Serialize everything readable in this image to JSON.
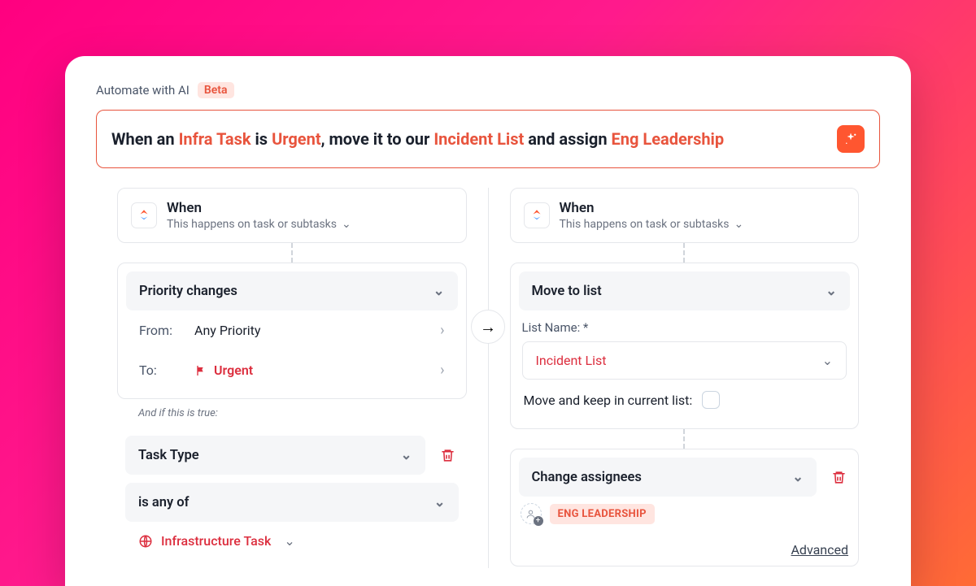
{
  "header": {
    "title": "Automate with AI",
    "badge": "Beta"
  },
  "prompt": {
    "prefix": "When an ",
    "h1": "Infra Task",
    "mid1": " is ",
    "h2": "Urgent",
    "mid2": ", move it to our ",
    "h3": "Incident List",
    "mid3": " and assign ",
    "h4": "Eng Leadership"
  },
  "left": {
    "when": {
      "title": "When",
      "sub": "This happens on task or subtasks"
    },
    "trigger": {
      "label": "Priority changes",
      "from_lbl": "From:",
      "from_val": "Any Priority",
      "to_lbl": "To:",
      "to_val": "Urgent"
    },
    "cond_hdr": "And if this is true:",
    "cond": {
      "field": "Task Type",
      "op": "is any of",
      "value": "Infrastructure Task"
    }
  },
  "right": {
    "when": {
      "title": "When",
      "sub": "This happens on task or subtasks"
    },
    "action1": {
      "label": "Move to list",
      "field_lbl": "List Name: *",
      "value": "Incident List",
      "keep_lbl": "Move and keep in current list:"
    },
    "action2": {
      "label": "Change assignees",
      "tag": "ENG LEADERSHIP",
      "adv": "Advanced"
    }
  }
}
